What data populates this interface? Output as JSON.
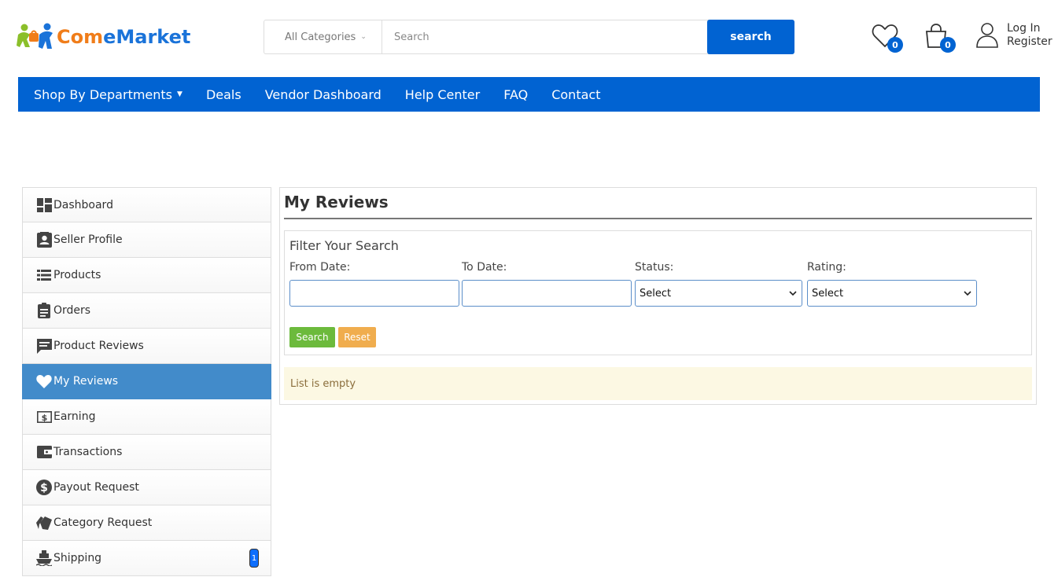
{
  "brand": {
    "name_part1": "Com",
    "name_part2": "eMarket"
  },
  "search": {
    "category": "All Categories",
    "placeholder": "Search",
    "button": "search"
  },
  "header": {
    "wishlist_count": "0",
    "cart_count": "0",
    "login": "Log In",
    "register": "Register"
  },
  "nav": {
    "items": [
      {
        "label": "Shop By Departments",
        "caret": "▼"
      },
      {
        "label": "Deals"
      },
      {
        "label": "Vendor Dashboard"
      },
      {
        "label": "Help Center"
      },
      {
        "label": "FAQ"
      },
      {
        "label": "Contact"
      }
    ]
  },
  "sidebar": {
    "items": [
      {
        "label": "Dashboard",
        "icon": "dashboard-icon"
      },
      {
        "label": "Seller Profile",
        "icon": "profile-icon"
      },
      {
        "label": "Products",
        "icon": "list-icon"
      },
      {
        "label": "Orders",
        "icon": "clipboard-icon"
      },
      {
        "label": "Product Reviews",
        "icon": "comment-icon"
      },
      {
        "label": "My Reviews",
        "icon": "heart-icon",
        "active": true
      },
      {
        "label": "Earning",
        "icon": "money-icon"
      },
      {
        "label": "Transactions",
        "icon": "wallet-icon"
      },
      {
        "label": "Payout Request",
        "icon": "dollar-icon"
      },
      {
        "label": "Category Request",
        "icon": "tags-icon"
      },
      {
        "label": "Shipping",
        "icon": "ship-icon",
        "badge": "1"
      }
    ]
  },
  "main": {
    "title": "My Reviews",
    "filter": {
      "heading": "Filter Your Search",
      "from_label": "From Date:",
      "to_label": "To Date:",
      "status_label": "Status:",
      "rating_label": "Rating:",
      "status_value": "Select",
      "rating_value": "Select",
      "search_button": "Search",
      "reset_button": "Reset"
    },
    "empty_message": "List is empty"
  },
  "colors": {
    "primary": "#0163d2",
    "active": "#428bca",
    "search_btn": "#6cba3c",
    "reset_btn": "#f0ad4e",
    "alert_bg": "#fcf8e3"
  }
}
